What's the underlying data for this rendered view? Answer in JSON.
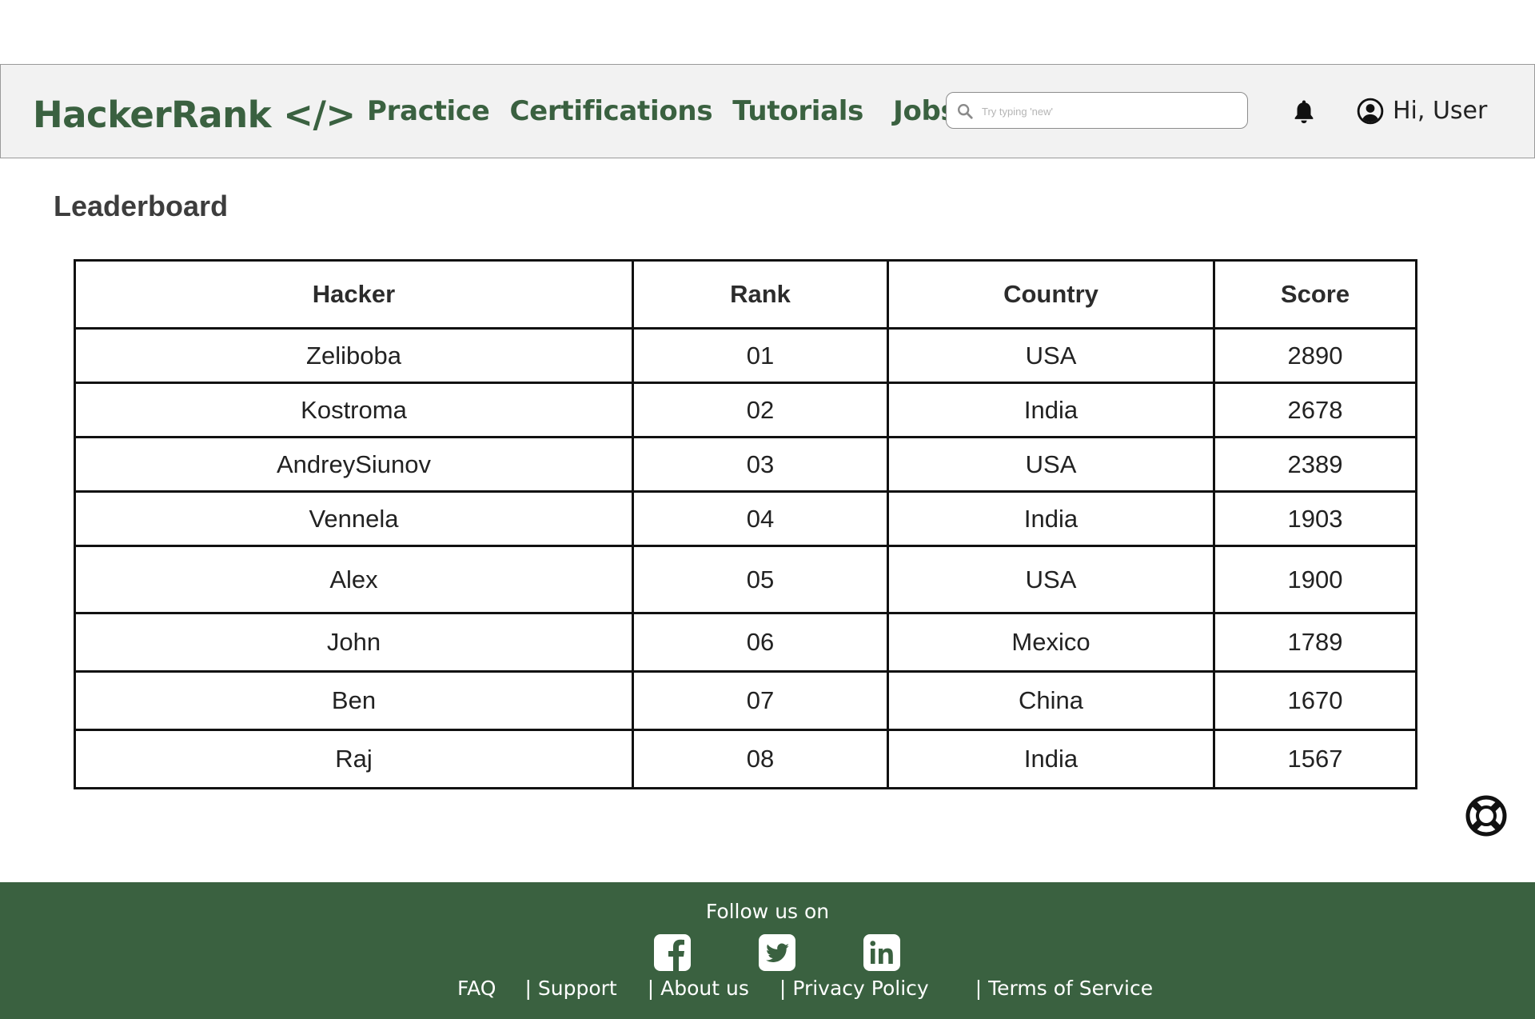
{
  "header": {
    "logo": "HackerRank </>",
    "nav": [
      "Practice",
      "Certifications",
      "Tutorials",
      "Jobs"
    ],
    "search_placeholder": "Try typing 'new'",
    "greeting": "Hi, User"
  },
  "main": {
    "title": "Leaderboard",
    "table": {
      "columns": [
        "Hacker",
        "Rank",
        "Country",
        "Score"
      ],
      "rows": [
        [
          "Zeliboba",
          "01",
          "USA",
          "2890"
        ],
        [
          "Kostroma",
          "02",
          "India",
          "2678"
        ],
        [
          "AndreySiunov",
          "03",
          "USA",
          "2389"
        ],
        [
          "Vennela",
          "04",
          "India",
          "1903"
        ],
        [
          "Alex",
          "05",
          "USA",
          "1900"
        ],
        [
          "John",
          "06",
          "Mexico",
          "1789"
        ],
        [
          "Ben",
          "07",
          "China",
          "1670"
        ],
        [
          "Raj",
          "08",
          "India",
          "1567"
        ]
      ]
    }
  },
  "footer": {
    "follow_text": "Follow us on",
    "social_icons": [
      "facebook-icon",
      "twitter-icon",
      "linkedin-icon"
    ],
    "links": [
      "FAQ",
      "Support",
      "About us",
      "Privacy Policy",
      "Terms of Service"
    ],
    "separator": "|"
  },
  "colors": {
    "brand_green": "#3a6140",
    "navbar_bg": "#f2f2f2",
    "footer_bg": "#3a6140"
  }
}
